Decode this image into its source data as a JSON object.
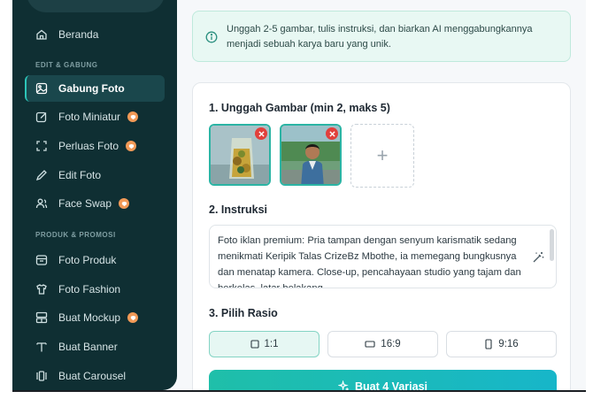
{
  "sidebar": {
    "items_top": [
      {
        "label": "Beranda",
        "icon": "home-icon"
      }
    ],
    "section_edit": "EDIT & GABUNG",
    "items_edit": [
      {
        "label": "Gabung Foto",
        "icon": "image-icon",
        "active": true,
        "badge": false
      },
      {
        "label": "Foto Miniatur",
        "icon": "edit-square-icon",
        "badge": true
      },
      {
        "label": "Perluas Foto",
        "icon": "expand-icon",
        "badge": true
      },
      {
        "label": "Edit Foto",
        "icon": "pencil-icon",
        "badge": false
      },
      {
        "label": "Face Swap",
        "icon": "face-icon",
        "badge": true
      }
    ],
    "section_product": "PRODUK & PROMOSI",
    "items_product": [
      {
        "label": "Foto Produk",
        "icon": "product-icon",
        "badge": false
      },
      {
        "label": "Foto Fashion",
        "icon": "shirt-icon",
        "badge": false
      },
      {
        "label": "Buat Mockup",
        "icon": "mockup-icon",
        "badge": true
      },
      {
        "label": "Buat Banner",
        "icon": "text-icon",
        "badge": false
      },
      {
        "label": "Buat Carousel",
        "icon": "carousel-icon",
        "badge": false
      }
    ]
  },
  "info": {
    "text": "Unggah 2-5 gambar, tulis instruksi, dan biarkan AI menggabungkannya menjadi sebuah karya baru yang unik."
  },
  "upload": {
    "heading": "1. Unggah Gambar (min 2, maks 5)",
    "add_symbol": "+"
  },
  "instruction": {
    "heading": "2. Instruksi",
    "text": "Foto iklan premium: Pria tampan dengan senyum karismatik sedang menikmati Keripik Talas CrizeBz Mbothe, ia memegang bungkusnya dan menatap kamera. Close-up, pencahayaan studio yang tajam dan berkelas, latar belakang"
  },
  "ratio": {
    "heading": "3. Pilih Rasio",
    "options": [
      {
        "label": "1:1",
        "selected": true
      },
      {
        "label": "16:9",
        "selected": false
      },
      {
        "label": "9:16",
        "selected": false
      }
    ]
  },
  "generate": {
    "label": "Buat 4 Variasi"
  },
  "colors": {
    "sidebar_bg": "#0f2f33",
    "accent": "#2bb4a4",
    "badge": "#f29a57"
  }
}
